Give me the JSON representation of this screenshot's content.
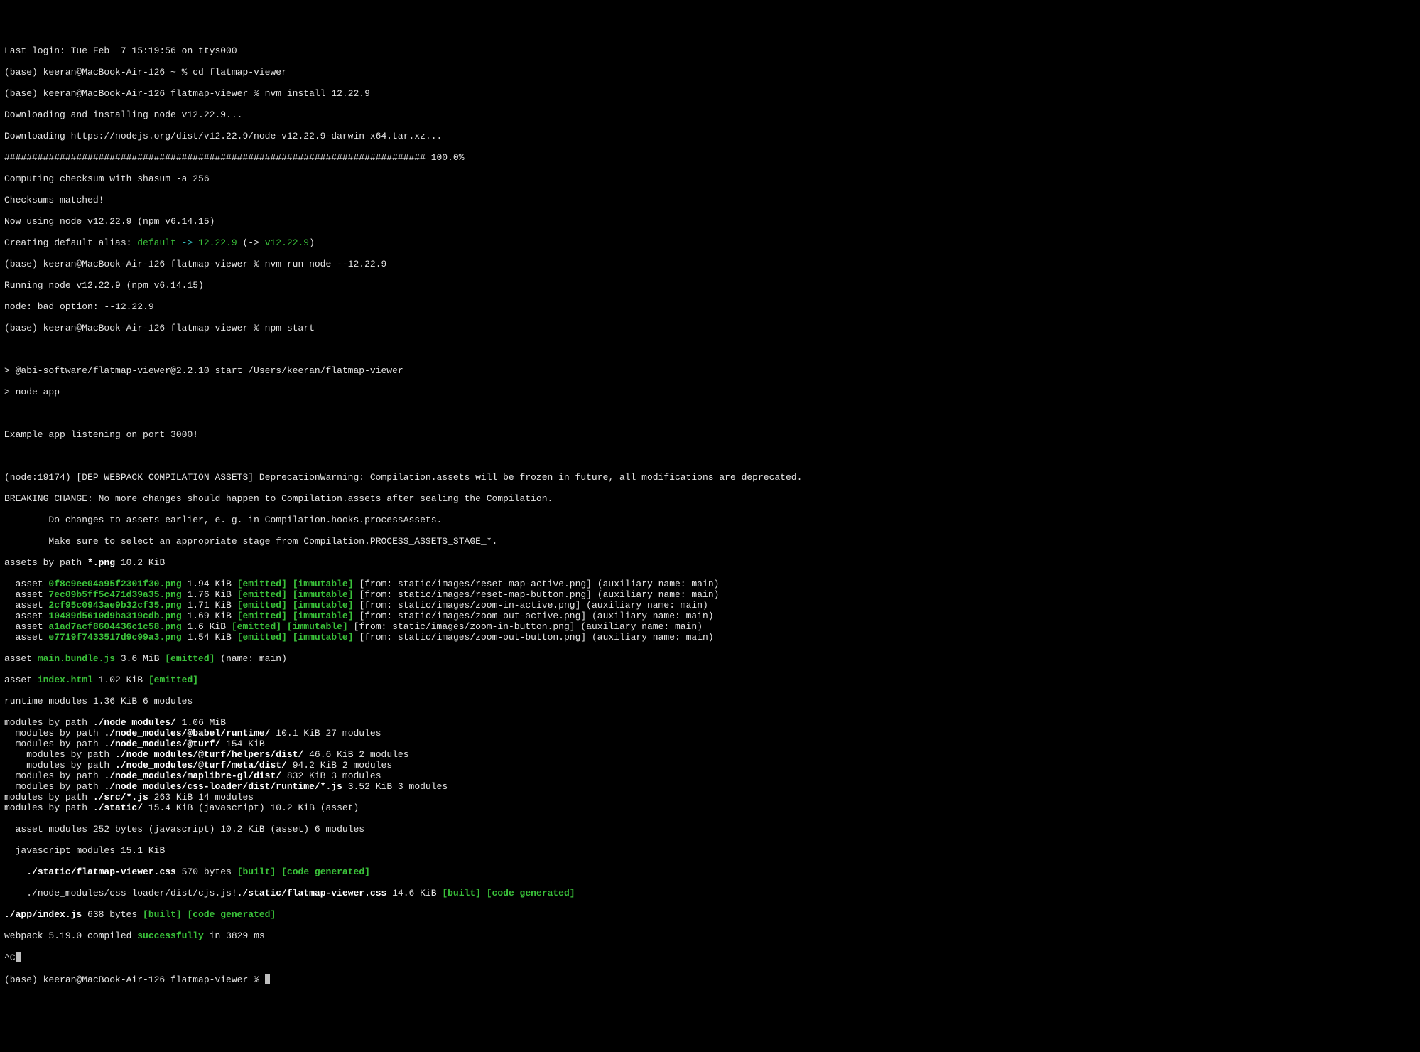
{
  "lastLogin": "Last login: Tue Feb  7 15:19:56 on ttys000",
  "promptHome": "(base) keeran@MacBook-Air-126 ~ % ",
  "promptViewer": "(base) keeran@MacBook-Air-126 flatmap-viewer % ",
  "cmd": {
    "cd": "cd flatmap-viewer",
    "nvmInstall": "nvm install 12.22.9",
    "nvmRun": "nvm run node --12.22.9",
    "npmStart": "npm start"
  },
  "nvm": {
    "downloading": "Downloading and installing node v12.22.9...",
    "downloadUrl": "Downloading https://nodejs.org/dist/v12.22.9/node-v12.22.9-darwin-x64.tar.xz...",
    "progress": "############################################################################ 100.0%",
    "checksum": "Computing checksum with shasum -a 256",
    "matched": "Checksums matched!",
    "nowUsing": "Now using node v12.22.9 (npm v6.14.15)",
    "aliasPrefix": "Creating default alias: ",
    "aliasDefault": "default",
    "aliasArrow1": " -> ",
    "aliasVer1": "12.22.9",
    "aliasParen1": " (-> ",
    "aliasVer2": "v12.22.9",
    "aliasParen2": ")",
    "running": "Running node v12.22.9 (npm v6.14.15)",
    "badOption": "node: bad option: --12.22.9"
  },
  "npm": {
    "startLine": "> @abi-software/flatmap-viewer@2.2.10 start /Users/keeran/flatmap-viewer",
    "nodeApp": "> node app",
    "listening": "Example app listening on port 3000!",
    "depWarning": "(node:19174) [DEP_WEBPACK_COMPILATION_ASSETS] DeprecationWarning: Compilation.assets will be frozen in future, all modifications are deprecated.",
    "breaking": "BREAKING CHANGE: No more changes should happen to Compilation.assets after sealing the Compilation.",
    "doChanges": "        Do changes to assets earlier, e. g. in Compilation.hooks.processAssets.",
    "makeSure": "        Make sure to select an appropriate stage from Compilation.PROCESS_ASSETS_STAGE_*."
  },
  "assetsHeader": {
    "pre": "assets by path ",
    "glob": "*.png",
    "post": " 10.2 KiB"
  },
  "assets": [
    {
      "indent": "  ",
      "label": "asset ",
      "name": "0f8c9ee04a95f2301f30.png",
      "size": " 1.94 KiB ",
      "tag1": "[emitted]",
      "sep": " ",
      "tag2": "[immutable]",
      "post": " [from: static/images/reset-map-active.png] (auxiliary name: main)"
    },
    {
      "indent": "  ",
      "label": "asset ",
      "name": "7ec09b5ff5c471d39a35.png",
      "size": " 1.76 KiB ",
      "tag1": "[emitted]",
      "sep": " ",
      "tag2": "[immutable]",
      "post": " [from: static/images/reset-map-button.png] (auxiliary name: main)"
    },
    {
      "indent": "  ",
      "label": "asset ",
      "name": "2cf95c0943ae9b32cf35.png",
      "size": " 1.71 KiB ",
      "tag1": "[emitted]",
      "sep": " ",
      "tag2": "[immutable]",
      "post": " [from: static/images/zoom-in-active.png] (auxiliary name: main)"
    },
    {
      "indent": "  ",
      "label": "asset ",
      "name": "10489d5610d9ba319cdb.png",
      "size": " 1.69 KiB ",
      "tag1": "[emitted]",
      "sep": " ",
      "tag2": "[immutable]",
      "post": " [from: static/images/zoom-out-active.png] (auxiliary name: main)"
    },
    {
      "indent": "  ",
      "label": "asset ",
      "name": "a1ad7acf8604436c1c58.png",
      "size": " 1.6 KiB ",
      "tag1": "[emitted]",
      "sep": " ",
      "tag2": "[immutable]",
      "post": " [from: static/images/zoom-in-button.png] (auxiliary name: main)"
    },
    {
      "indent": "  ",
      "label": "asset ",
      "name": "e7719f7433517d9c99a3.png",
      "size": " 1.54 KiB ",
      "tag1": "[emitted]",
      "sep": " ",
      "tag2": "[immutable]",
      "post": " [from: static/images/zoom-out-button.png] (auxiliary name: main)"
    }
  ],
  "mainBundle": {
    "pre": "asset ",
    "name": "main.bundle.js",
    "size": " 3.6 MiB ",
    "tag": "[emitted]",
    "post": " (name: main)"
  },
  "indexHtml": {
    "pre": "asset ",
    "name": "index.html",
    "size": " 1.02 KiB ",
    "tag": "[emitted]"
  },
  "runtime": "runtime modules 1.36 KiB 6 modules",
  "mods": [
    {
      "indent": "",
      "pre": "modules by path ",
      "bold": "./node_modules/",
      "post": " 1.06 MiB"
    },
    {
      "indent": "  ",
      "pre": "modules by path ",
      "bold": "./node_modules/@babel/runtime/",
      "post": " 10.1 KiB 27 modules"
    },
    {
      "indent": "  ",
      "pre": "modules by path ",
      "bold": "./node_modules/@turf/",
      "post": " 154 KiB"
    },
    {
      "indent": "    ",
      "pre": "modules by path ",
      "bold": "./node_modules/@turf/helpers/dist/",
      "post": " 46.6 KiB 2 modules"
    },
    {
      "indent": "    ",
      "pre": "modules by path ",
      "bold": "./node_modules/@turf/meta/dist/",
      "post": " 94.2 KiB 2 modules"
    },
    {
      "indent": "  ",
      "pre": "modules by path ",
      "bold": "./node_modules/maplibre-gl/dist/",
      "post": " 832 KiB 3 modules"
    },
    {
      "indent": "  ",
      "pre": "modules by path ",
      "bold": "./node_modules/css-loader/dist/runtime/*.js",
      "post": " 3.52 KiB 3 modules"
    },
    {
      "indent": "",
      "pre": "modules by path ",
      "bold": "./src/*.js",
      "post": " 263 KiB 14 modules"
    },
    {
      "indent": "",
      "pre": "modules by path ",
      "bold": "./static/",
      "post": " 15.4 KiB (javascript) 10.2 KiB (asset)"
    }
  ],
  "assetModules": "  asset modules 252 bytes (javascript) 10.2 KiB (asset) 6 modules",
  "jsModules": "  javascript modules 15.1 KiB",
  "flatmapCss": {
    "indent": "    ",
    "bold": "./static/flatmap-viewer.css",
    "size": " 570 bytes ",
    "tag1": "[built]",
    "sep": " ",
    "tag2": "[code generated]"
  },
  "cssLoaderLine": {
    "indent": "    ",
    "pre": "./node_modules/css-loader/dist/cjs.js!",
    "bold": "./static/flatmap-viewer.css",
    "size": " 14.6 KiB ",
    "tag1": "[built]",
    "sep": " ",
    "tag2": "[code generated]"
  },
  "appIndex": {
    "bold": "./app/index.js",
    "size": " 638 bytes ",
    "tag1": "[built]",
    "sep": " ",
    "tag2": "[code generated]"
  },
  "webpack": {
    "pre": "webpack 5.19.0 compiled ",
    "success": "successfully",
    "post": " in 3829 ms"
  },
  "ctrlC": "^C"
}
